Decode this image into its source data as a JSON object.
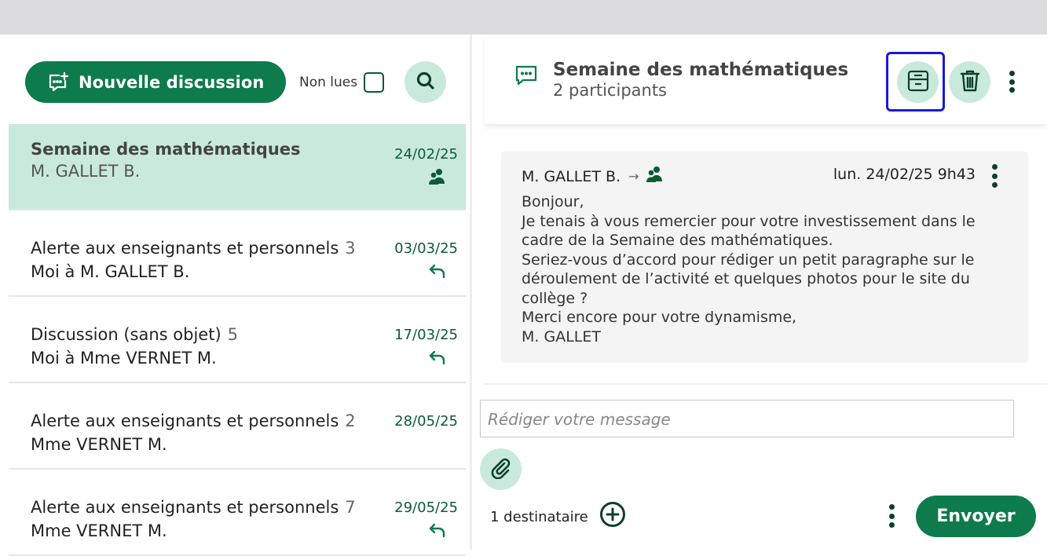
{
  "sidebar": {
    "new_discussion_label": "Nouvelle discussion",
    "unread_label": "Non lues",
    "unread_checked": false,
    "items": [
      {
        "title": "Semaine des mathématiques",
        "count": "",
        "subtitle": "M. GALLET B.",
        "date": "24/02/25",
        "icon": "group-icon",
        "active": true
      },
      {
        "title": "Alerte aux enseignants et personnels",
        "count": "3",
        "subtitle": "Moi à M. GALLET B.",
        "date": "03/03/25",
        "icon": "reply-icon",
        "active": false
      },
      {
        "title": "Discussion (sans objet)",
        "count": "5",
        "subtitle": "Moi à Mme VERNET M.",
        "date": "17/03/25",
        "icon": "reply-icon",
        "active": false
      },
      {
        "title": "Alerte aux enseignants et personnels",
        "count": "2",
        "subtitle": "Mme VERNET M.",
        "date": "28/05/25",
        "icon": "",
        "active": false
      },
      {
        "title": "Alerte aux enseignants et personnels",
        "count": "7",
        "subtitle": "Mme VERNET M.",
        "date": "29/05/25",
        "icon": "reply-icon",
        "active": false
      }
    ]
  },
  "conversation": {
    "title": "Semaine des mathématiques",
    "participants": "2 participants"
  },
  "message": {
    "author": "M. GALLET B.",
    "timestamp": "lun. 24/02/25 9h43",
    "lines": [
      "Bonjour,",
      "Je tenais à vous remercier pour votre investissement dans le cadre de la Semaine des mathématiques.",
      "Seriez-vous d’accord pour rédiger un petit paragraphe sur le déroulement de l’activité et quelques photos pour le site du collège ?",
      "Merci encore pour votre dynamisme,",
      "M. GALLET"
    ]
  },
  "composer": {
    "placeholder": "Rédiger votre message",
    "recipients": "1 destinataire",
    "send_label": "Envoyer"
  },
  "colors": {
    "primary": "#0d7b4c",
    "primary_light": "#c9eadb",
    "dark_green": "#0d5a38",
    "focus": "#1a1ad6"
  }
}
